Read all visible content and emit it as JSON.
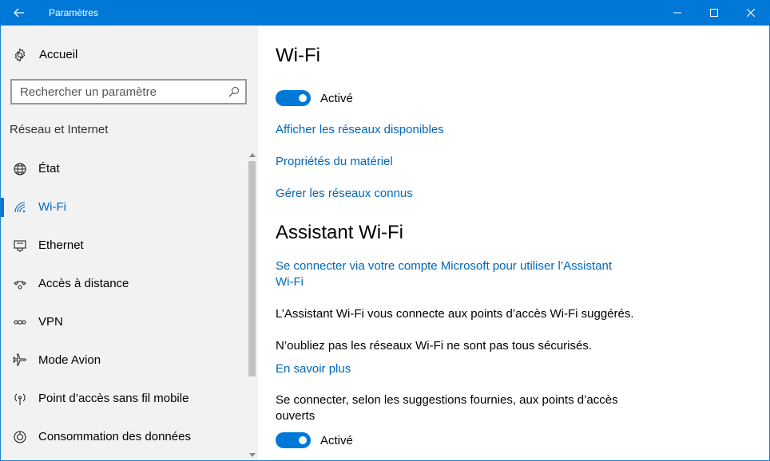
{
  "window": {
    "title": "Paramètres",
    "accent": "#0078d7"
  },
  "sidebar": {
    "home_label": "Accueil",
    "search_placeholder": "Rechercher un paramètre",
    "section_title": "Réseau et Internet",
    "items": [
      {
        "label": "État",
        "icon": "globe-icon",
        "active": false
      },
      {
        "label": "Wi-Fi",
        "icon": "wifi-icon",
        "active": true
      },
      {
        "label": "Ethernet",
        "icon": "ethernet-icon",
        "active": false
      },
      {
        "label": "Accès à distance",
        "icon": "dialup-icon",
        "active": false
      },
      {
        "label": "VPN",
        "icon": "vpn-icon",
        "active": false
      },
      {
        "label": "Mode Avion",
        "icon": "airplane-icon",
        "active": false
      },
      {
        "label": "Point d’accès sans fil mobile",
        "icon": "hotspot-icon",
        "active": false
      },
      {
        "label": "Consommation des données",
        "icon": "data-usage-icon",
        "active": false
      }
    ]
  },
  "main": {
    "title": "Wi-Fi",
    "wifi_toggle": {
      "label": "Activé",
      "on": true
    },
    "links": {
      "show_networks": "Afficher les réseaux disponibles",
      "hardware_props": "Propriétés du matériel",
      "manage_known": "Gérer les réseaux connus"
    },
    "sense": {
      "title": "Assistant Wi-Fi",
      "signin_link_line1": "Se connecter via votre compte Microsoft pour utiliser l’Assistant",
      "signin_link_line2": "Wi-Fi",
      "description": "L’Assistant Wi-Fi vous connecte aux points d’accès Wi-Fi suggérés.",
      "warning": "N’oubliez pas les réseaux Wi-Fi ne sont pas tous sécurisés.",
      "learn_more": "En savoir plus",
      "open_hotspots_line1": "Se connecter, selon les suggestions fournies, aux points d’accès",
      "open_hotspots_line2": "ouverts",
      "open_hotspots_toggle": {
        "label": "Activé",
        "on": true
      }
    }
  }
}
